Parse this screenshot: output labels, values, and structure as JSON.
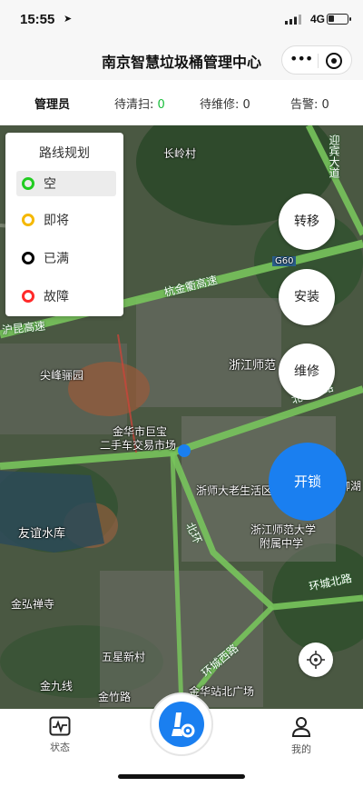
{
  "status_bar": {
    "time": "15:55",
    "network": "4G"
  },
  "app": {
    "title": "南京智慧垃圾桶管理中心"
  },
  "stats": {
    "role": "管理员",
    "pending_clean_label": "待清扫:",
    "pending_clean_value": "0",
    "pending_repair": "待维修: 0",
    "alarm": "告警: 0"
  },
  "legend": {
    "title": "路线规划",
    "items": [
      {
        "label": "空",
        "color": "#22cc22"
      },
      {
        "label": "即将",
        "color": "#f5b800"
      },
      {
        "label": "已满",
        "color": "#000000"
      },
      {
        "label": "故障",
        "color": "#ff2a2a"
      }
    ]
  },
  "actions": {
    "transfer": "转移",
    "install": "安装",
    "repair": "维修",
    "unlock": "开锁"
  },
  "map_labels": {
    "changling": "长岭村",
    "yingbin": "迎宾大道",
    "hangjinqu": "杭金衢高速",
    "g60": "G60",
    "hukun": "沪昆高速",
    "jianfeng": "尖峰骊园",
    "zhengshi": "浙江师范",
    "beierhuan": "北二环路",
    "jinhuashi": "金华市巨宝",
    "ershouche": "二手车交易市场",
    "liuhu": "柳湖",
    "laonian": "浙师大老生活区",
    "fuzhong1": "浙江师范大学",
    "fuzhong2": "附属中学",
    "youyi": "友谊水库",
    "beihuan": "北环",
    "huanchengbei": "环城北路",
    "jinhong": "金弘禅寺",
    "wuxing": "五星新村",
    "huanchengxi": "环城西路",
    "jinjiuxian": "金九线",
    "jinzhu": "金竹路",
    "beiguangchang": "金华站北广场"
  },
  "bottom_nav": {
    "status": "状态",
    "mine": "我的"
  },
  "colors": {
    "accent": "#1a7ff0",
    "clean_count": "#19be3b"
  }
}
